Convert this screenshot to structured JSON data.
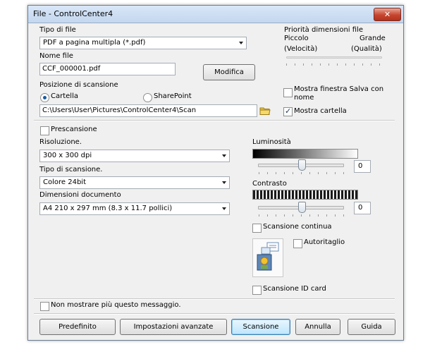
{
  "window": {
    "title": "File - ControlCenter4",
    "close_glyph": "✕"
  },
  "file_type": {
    "label": "Tipo di file",
    "value": "PDF a pagina multipla (*.pdf)"
  },
  "priority": {
    "label": "Priorità dimensioni file",
    "small": "Piccolo",
    "small_sub": "(Velocità)",
    "large": "Grande",
    "large_sub": "(Qualità)"
  },
  "file_name": {
    "label": "Nome file",
    "value": "CCF_000001.pdf",
    "modify_button": "Modifica"
  },
  "scan_location": {
    "label": "Posizione di scansione",
    "option_folder": "Cartella",
    "option_sharepoint": "SharePoint",
    "path": "C:\\Users\\User\\Pictures\\ControlCenter4\\Scan",
    "folder_icon": "folder-icon"
  },
  "show_save_as": {
    "label_line1": "Mostra finestra Salva con",
    "label_line2": "nome",
    "checked": false
  },
  "show_folder": {
    "label": "Mostra cartella",
    "checked": true
  },
  "prescan": {
    "label": "Prescansione",
    "checked": false
  },
  "resolution": {
    "label": "Risoluzione.",
    "value": "300 x 300 dpi"
  },
  "scan_type": {
    "label": "Tipo di scansione.",
    "value": "Colore 24bit"
  },
  "document_size": {
    "label": "Dimensioni documento",
    "value": "A4 210 x 297 mm (8.3 x 11.7 pollici)"
  },
  "brightness": {
    "label": "Luminosità",
    "value": "0"
  },
  "contrast": {
    "label": "Contrasto",
    "value": "0"
  },
  "continuous_scan": {
    "label": "Scansione continua",
    "checked": false
  },
  "auto_crop": {
    "label": "Autoritaglio",
    "checked": false,
    "icon": "autocrop-preview-icon"
  },
  "id_card_scan": {
    "label": "Scansione ID card",
    "checked": false
  },
  "dont_show": {
    "label": "Non mostrare più questo messaggio.",
    "checked": false
  },
  "buttons": {
    "default": "Predefinito",
    "advanced": "Impostazioni avanzate",
    "scan": "Scansione",
    "cancel": "Annulla",
    "help": "Guida"
  }
}
